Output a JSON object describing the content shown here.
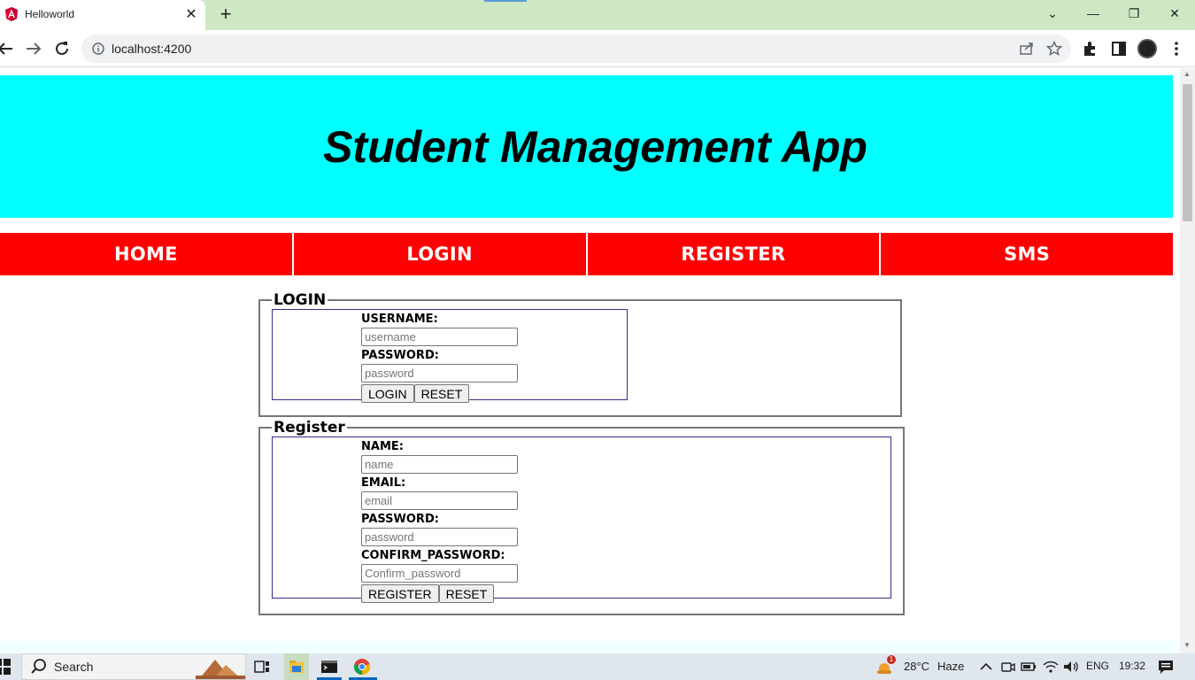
{
  "browser": {
    "tab_title": "Helloworld",
    "tab_close": "✕",
    "new_tab": "+",
    "url": "localhost:4200",
    "window_controls": {
      "dropdown": "⌄",
      "minimize": "—",
      "restore": "❐",
      "close": "✕"
    }
  },
  "page": {
    "app_title": "Student Management App",
    "nav": [
      "HOME",
      "LOGIN",
      "REGISTER",
      "SMS"
    ],
    "login": {
      "legend": "LOGIN",
      "username_label": "USERNAME:",
      "username_placeholder": "username",
      "password_label": "PASSWORD:",
      "password_placeholder": "password",
      "submit_label": "LOGIN",
      "reset_label": "RESET"
    },
    "register": {
      "legend": "Register",
      "name_label": "NAME:",
      "name_placeholder": "name",
      "email_label": "EMAIL:",
      "email_placeholder": "email",
      "password_label": "PASSWORD:",
      "password_placeholder": "password",
      "confirm_label": "CONFIRM_PASSWORD:",
      "confirm_placeholder": "Confirm_password",
      "submit_label": "REGISTER",
      "reset_label": "RESET"
    }
  },
  "taskbar": {
    "search_label": "Search",
    "weather_temp": "28°C",
    "weather_desc": "Haze",
    "weather_badge": "1",
    "language": "ENG",
    "time": "19:32"
  },
  "colors": {
    "header_bg": "#00ffff",
    "nav_bg": "#ff0000",
    "tabstrip_bg": "#cfe8c4"
  }
}
